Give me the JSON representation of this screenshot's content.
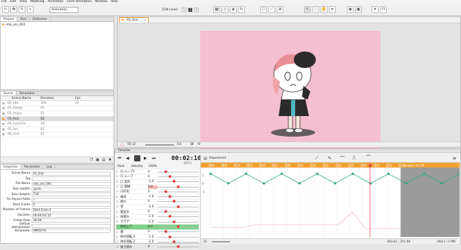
{
  "menu": [
    "File",
    "Edit",
    "View",
    "Modeling",
    "Animation",
    "Form Animation",
    "Window",
    "Help"
  ],
  "toolbar": {
    "mode_select": "Animation",
    "edit_level_label": "Edit Level",
    "levels": [
      "1",
      "2",
      "3"
    ]
  },
  "project": {
    "tabs": [
      "Project",
      "Part",
      "Deformer"
    ],
    "item": "nito_ani_001"
  },
  "scenes": {
    "tabs": [
      "Scene",
      "Templates"
    ],
    "headers": [
      "Scene Name",
      "Duration",
      "Fps"
    ],
    "rows": [
      {
        "name": "00_idle",
        "duration": "300",
        "fps": "30"
      },
      {
        "name": "01_happy",
        "duration": "61",
        "fps": ""
      },
      {
        "name": "02_angry",
        "duration": "61",
        "fps": ""
      },
      {
        "name": "03_fear",
        "duration": "65",
        "fps": ""
      },
      {
        "name": "04_surprise",
        "duration": "42",
        "fps": ""
      },
      {
        "name": "05_fun",
        "duration": "61",
        "fps": ""
      },
      {
        "name": "06_love",
        "duration": "61",
        "fps": ""
      }
    ]
  },
  "inspector": {
    "tabs": [
      "Inspector",
      "Parameter",
      "Log"
    ],
    "props": [
      {
        "label": "Scene Name",
        "value": "03_fear"
      },
      {
        "label": "Tag",
        "value": ""
      },
      {
        "label": "File Name",
        "value": "nito_ani_001"
      },
      {
        "label": "Size (width)",
        "value": "1079"
      },
      {
        "label": "Size (height)",
        "value": "719"
      },
      {
        "label": "Fix Aspect Ratio",
        "value": "✓"
      },
      {
        "label": "Start Frame",
        "value": "0"
      },
      {
        "label": "Number of Frames",
        "value": "Start from 0"
      },
      {
        "label": "Duration",
        "value": "00:00:02:15"
      },
      {
        "label": "Frame Rate",
        "value": "30.00"
      },
      {
        "label": "Default Interpolation",
        "value": ""
      },
      {
        "label": "Parameter",
        "value": "SMOOTH"
      }
    ]
  },
  "scene_tab": "03_fear",
  "canvas": {
    "bg": "#f4bfd1",
    "zoom": "50.12",
    "page": "1/1"
  },
  "timeline": {
    "title": "Timeline",
    "time": "00:02:10",
    "frame": "0071",
    "root_label": "Root",
    "mode_label": "Velocity",
    "pct": "100%",
    "layers": [
      {
        "name": "口 ループ1",
        "val": "0"
      },
      {
        "name": "口 ループ",
        "val": "0"
      },
      {
        "name": "口 変形",
        "val": "-1.0"
      },
      {
        "name": "口 開閉",
        "val": "0.0"
      },
      {
        "name": "口の形",
        "val": "0"
      },
      {
        "name": "頭部",
        "val": "-1.0"
      },
      {
        "name": "揺れ",
        "val": "0"
      },
      {
        "name": "涙",
        "val": "-1.0"
      },
      {
        "name": "髪変形",
        "val": "0"
      },
      {
        "name": "体揺れ",
        "val": "-1.0"
      },
      {
        "name": "グラデ",
        "val": "-1.0"
      },
      {
        "name": "体の上下",
        "val": "0.0"
      },
      {
        "name": "腕",
        "val": "0"
      },
      {
        "name": "体の回転 X",
        "val": "-1.0"
      },
      {
        "name": "体の回転 Z",
        "val": "-1.0"
      },
      {
        "name": "後ろ揺れ",
        "val": "0"
      }
    ]
  },
  "dopesheet": {
    "title": "Dopesheet",
    "ticks": [
      "0:00",
      "0:05",
      "0:10",
      "0:15",
      "0:20",
      "0:25",
      "1:00",
      "1:05",
      "1:10",
      "1:15",
      "1:20",
      "1:25",
      "2:00",
      "2:05",
      "2:10",
      "2:15"
    ],
    "y_labels": [
      "1",
      "0",
      "-1"
    ],
    "duration_label": "duration 2s:15f",
    "accent": "#f0a030",
    "curve_color": "#2aaa7a",
    "playhead_color": "#e84040"
  },
  "status": {
    "coords": "-203.61 , 371.58",
    "zoom": "263.1 / 1796"
  }
}
